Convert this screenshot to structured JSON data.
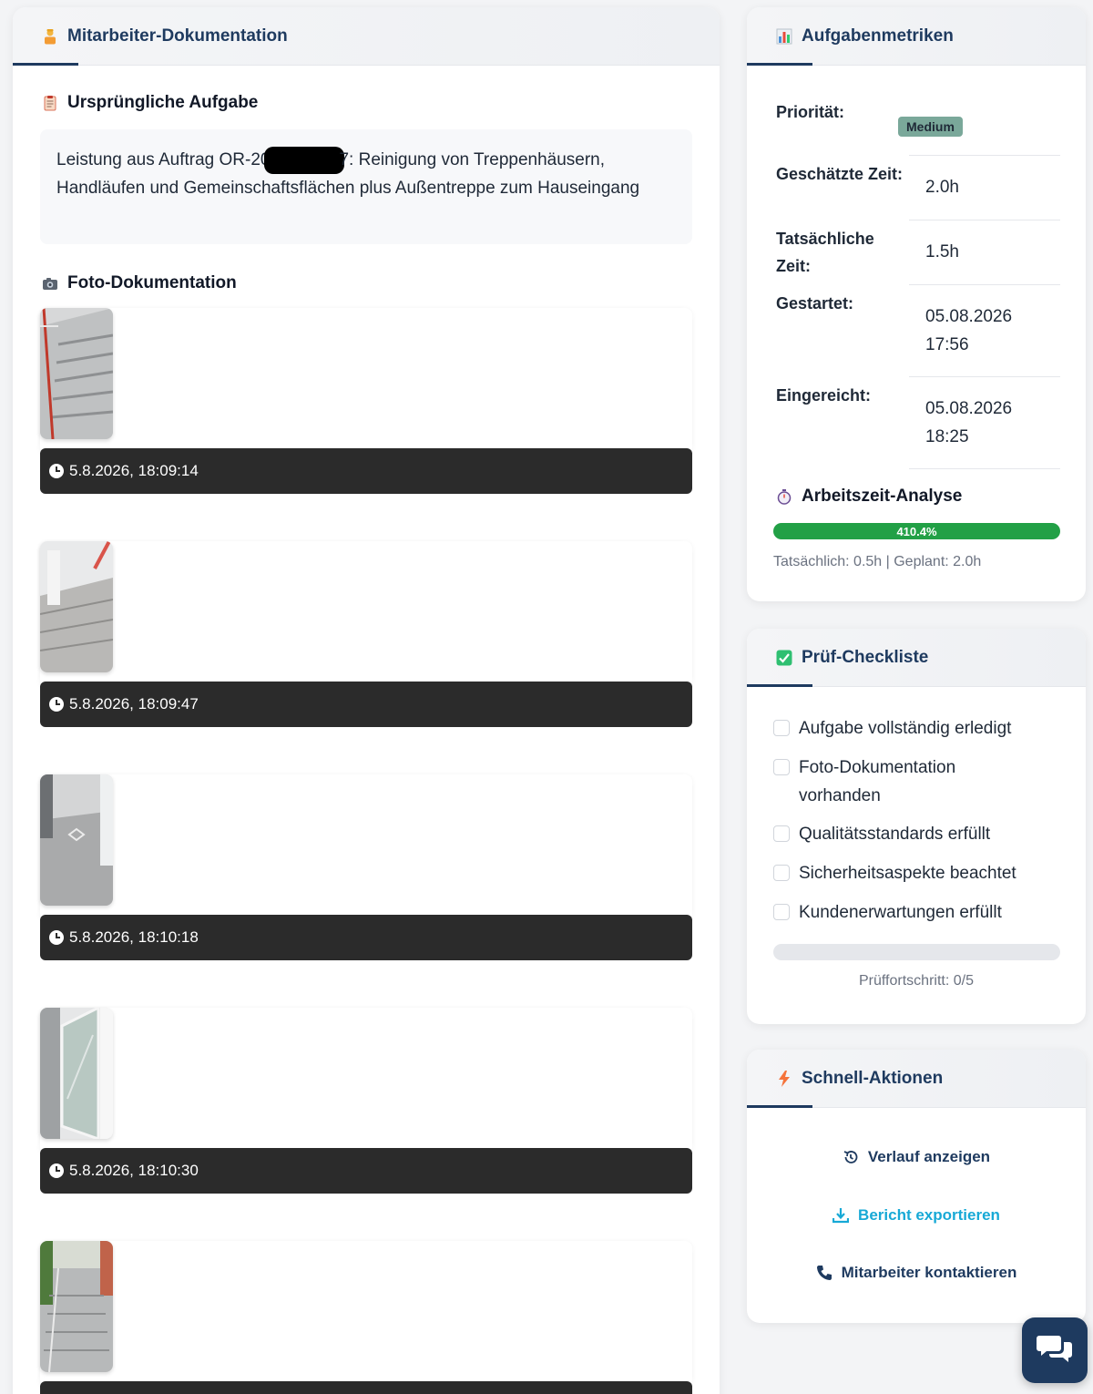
{
  "left": {
    "header_title": "Mitarbeiter-Dokumentation",
    "task_section_title": "Ursprüngliche Aufgabe",
    "task_text_before": "Leistung aus Auftrag OR-20",
    "task_text_after": "7: Reinigung von Treppenhäusern, Handläufen und Gemeinschaftsflächen plus Außentreppe zum Hauseingang",
    "photo_section_title": "Foto-Dokumentation",
    "photos": [
      {
        "timestamp": "5.8.2026, 18:09:14"
      },
      {
        "timestamp": "5.8.2026, 18:09:47"
      },
      {
        "timestamp": "5.8.2026, 18:10:18"
      },
      {
        "timestamp": "5.8.2026, 18:10:30"
      },
      {
        "timestamp": ""
      }
    ]
  },
  "metrics": {
    "header_title": "Aufgabenmetriken",
    "priority_label": "Priorität:",
    "priority_value": "Medium",
    "estimated_label": "Geschätzte Zeit:",
    "estimated_value": "2.0h",
    "actual_label": "Tatsächliche Zeit:",
    "actual_value": "1.5h",
    "started_label": "Gestartet:",
    "started_value": "05.08.2026 17:56",
    "submitted_label": "Eingereicht:",
    "submitted_value": "05.08.2026 18:25",
    "analysis_title": "Arbeitszeit-Analyse",
    "analysis_percent_label": "410.4%",
    "analysis_percent": 410.4,
    "analysis_summary": "Tatsächlich: 0.5h | Geplant: 2.0h"
  },
  "checklist": {
    "header_title": "Prüf-Checkliste",
    "items": [
      {
        "label": "Aufgabe vollständig erledigt",
        "checked": false
      },
      {
        "label": "Foto-Dokumentation vorhanden",
        "checked": false
      },
      {
        "label": "Qualitätsstandards erfüllt",
        "checked": false
      },
      {
        "label": "Sicherheitsaspekte beachtet",
        "checked": false
      },
      {
        "label": "Kundenerwartungen erfüllt",
        "checked": false
      }
    ],
    "progress_text": "Prüffortschritt: 0/5",
    "progress_fraction": 0
  },
  "actions": {
    "header_title": "Schnell-Aktionen",
    "history": "Verlauf anzeigen",
    "export": "Bericht exportieren",
    "contact": "Mitarbeiter kontaktieren"
  },
  "colors": {
    "primary": "#1e3a5f",
    "success": "#22a046",
    "badge": "#7aa89a",
    "export": "#17a9d6",
    "timestamp_bar": "#2b2b2b"
  },
  "icons": {
    "employee": "worker-icon",
    "metrics": "bar-chart-icon",
    "task": "clipboard-icon",
    "photo": "camera-icon",
    "analysis": "stopwatch-icon",
    "checklist": "check-square-icon",
    "actions": "lightning-icon",
    "history": "history-icon",
    "export": "download-icon",
    "contact": "phone-icon",
    "chat": "chat-icon"
  }
}
